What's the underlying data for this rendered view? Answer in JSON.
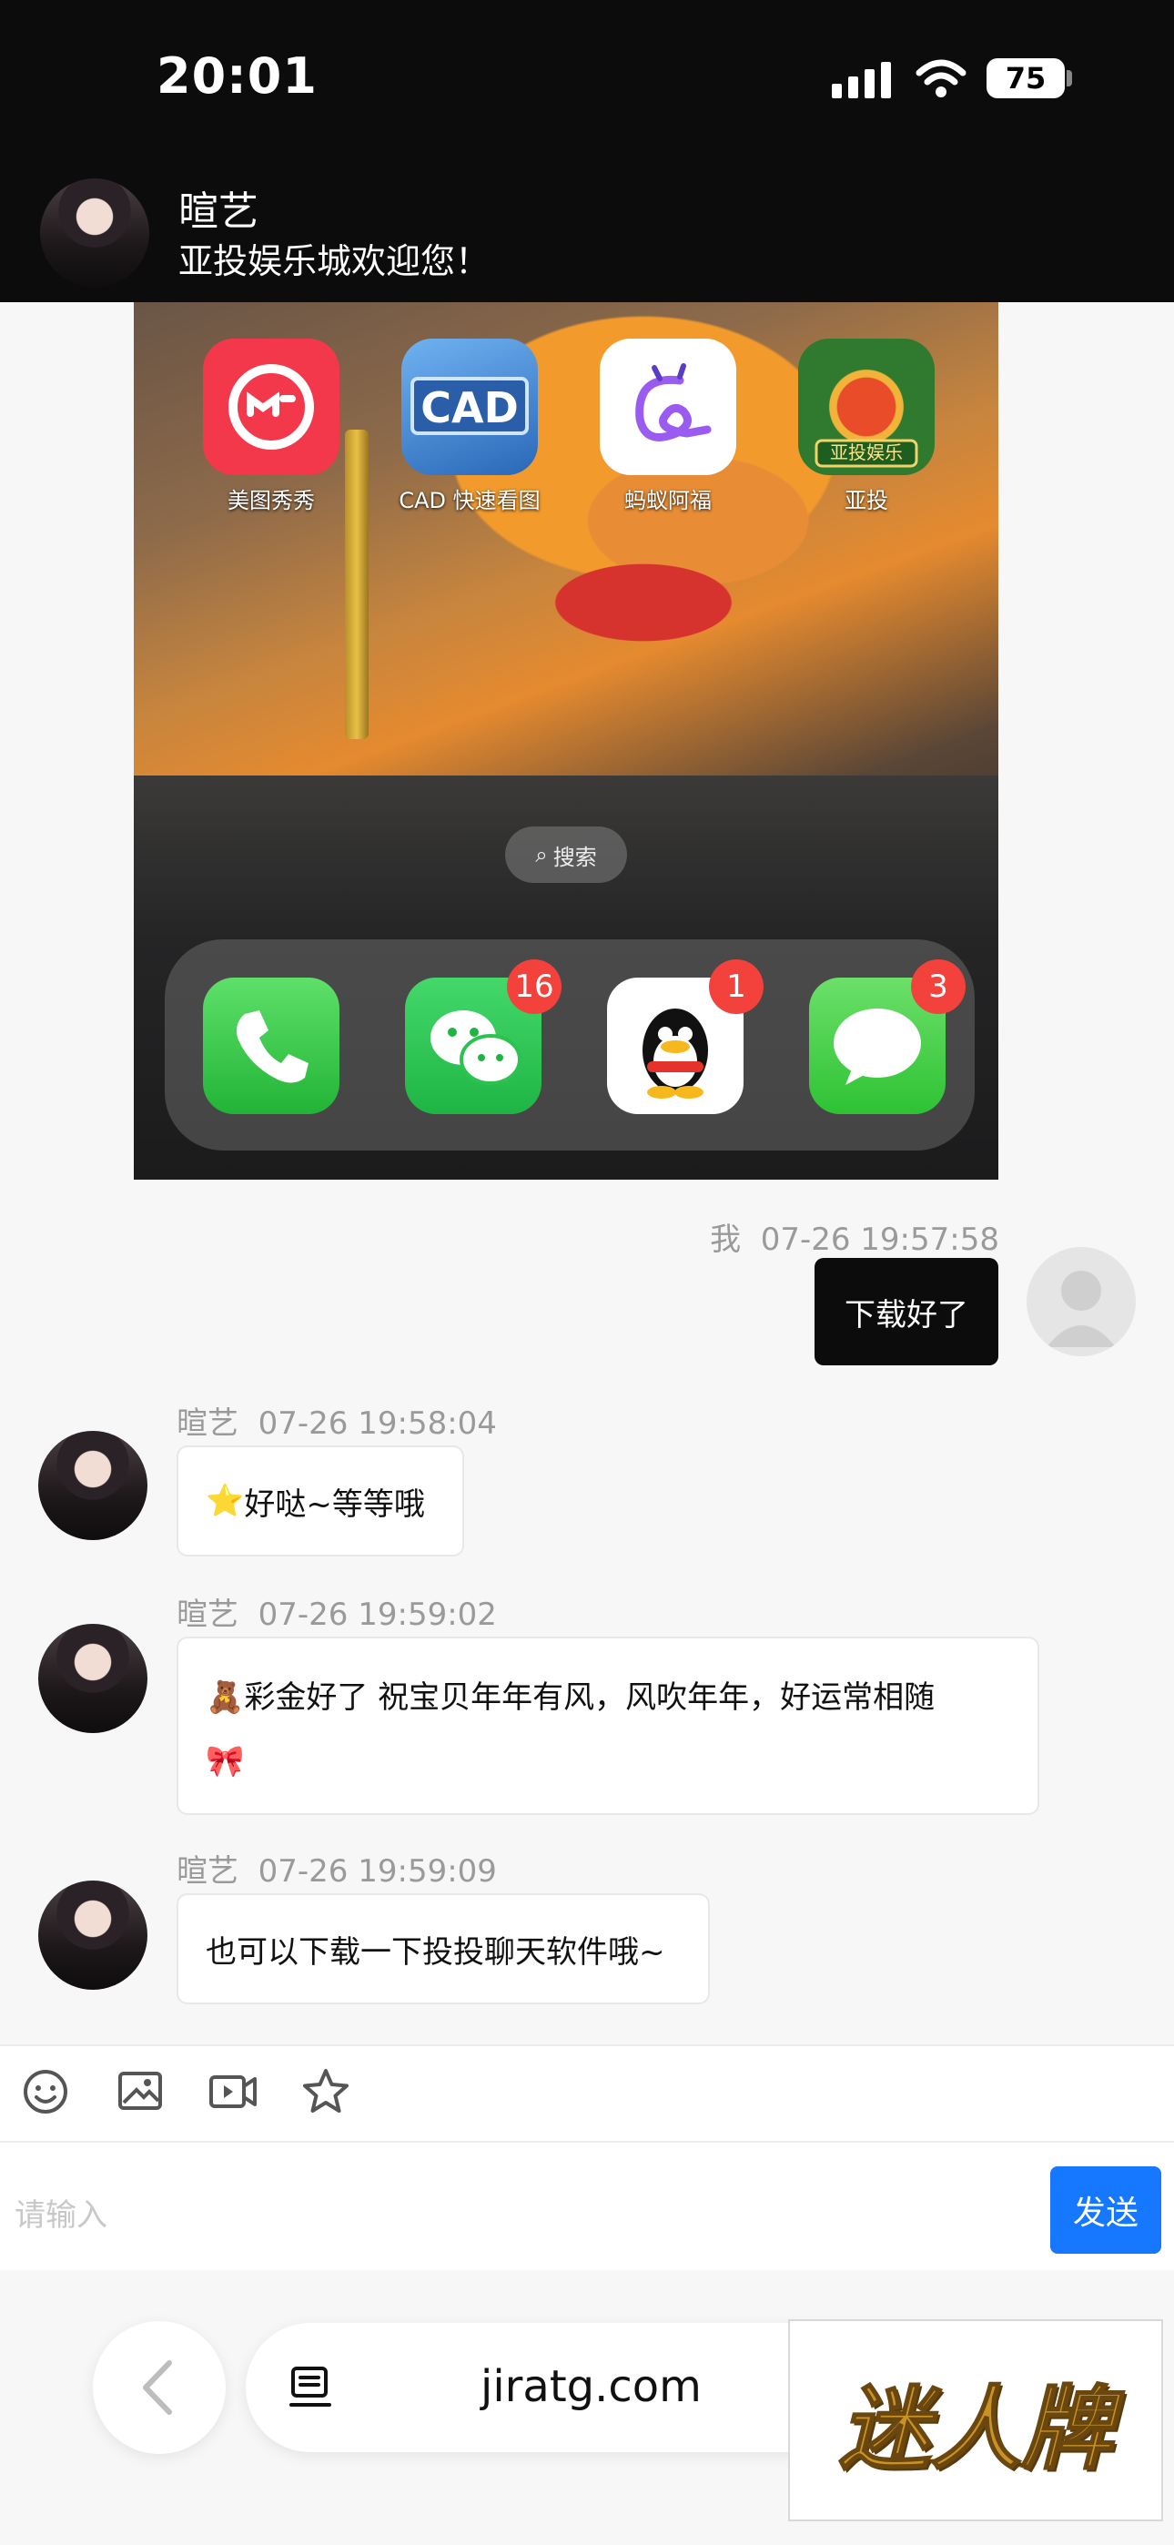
{
  "status_bar": {
    "time": "20:01",
    "battery": "75"
  },
  "header": {
    "contact_name": "暄艺",
    "subtitle": "亚投娱乐城欢迎您！"
  },
  "shared_screenshot": {
    "apps": [
      {
        "label": "美图秀秀",
        "icon": "meitu-icon",
        "color": "#f2384a"
      },
      {
        "label": "CAD 快速看图",
        "icon": "cad-icon",
        "color": "#3f7fcf"
      },
      {
        "label": "蚂蚁阿福",
        "icon": "ant-afu-icon",
        "color": "#ffffff"
      },
      {
        "label": "亚投",
        "icon": "yatou-casino-icon",
        "color": "#2f7a2f"
      }
    ],
    "search_label": "搜索",
    "dock": [
      {
        "icon": "phone-icon",
        "badge": ""
      },
      {
        "icon": "wechat-icon",
        "badge": "16"
      },
      {
        "icon": "qq-icon",
        "badge": "1"
      },
      {
        "icon": "messages-icon",
        "badge": "3"
      }
    ]
  },
  "messages": [
    {
      "sender": "我",
      "time": "07-26 19:57:58",
      "text": "下载好了",
      "outgoing": true
    },
    {
      "sender": "暄艺",
      "time": "07-26 19:58:04",
      "emoji": "⭐",
      "text": "好哒~等等哦",
      "outgoing": false
    },
    {
      "sender": "暄艺",
      "time": "07-26 19:59:02",
      "emoji": "🧸",
      "text": "彩金好了 祝宝贝年年有风，风吹年年，好运常相随",
      "emoji_end": "🎀",
      "outgoing": false
    },
    {
      "sender": "暄艺",
      "time": "07-26 19:59:09",
      "text": "也可以下载一下投投聊天软件哦~",
      "outgoing": false
    }
  ],
  "composer": {
    "placeholder": "请输入",
    "send_label": "发送"
  },
  "browser": {
    "url": "jiratg.com"
  },
  "ad": {
    "text": "迷人牌"
  },
  "colors": {
    "send": "#1677ff",
    "badge": "#f3413c",
    "outgoing_bubble": "#0c0c0c"
  }
}
